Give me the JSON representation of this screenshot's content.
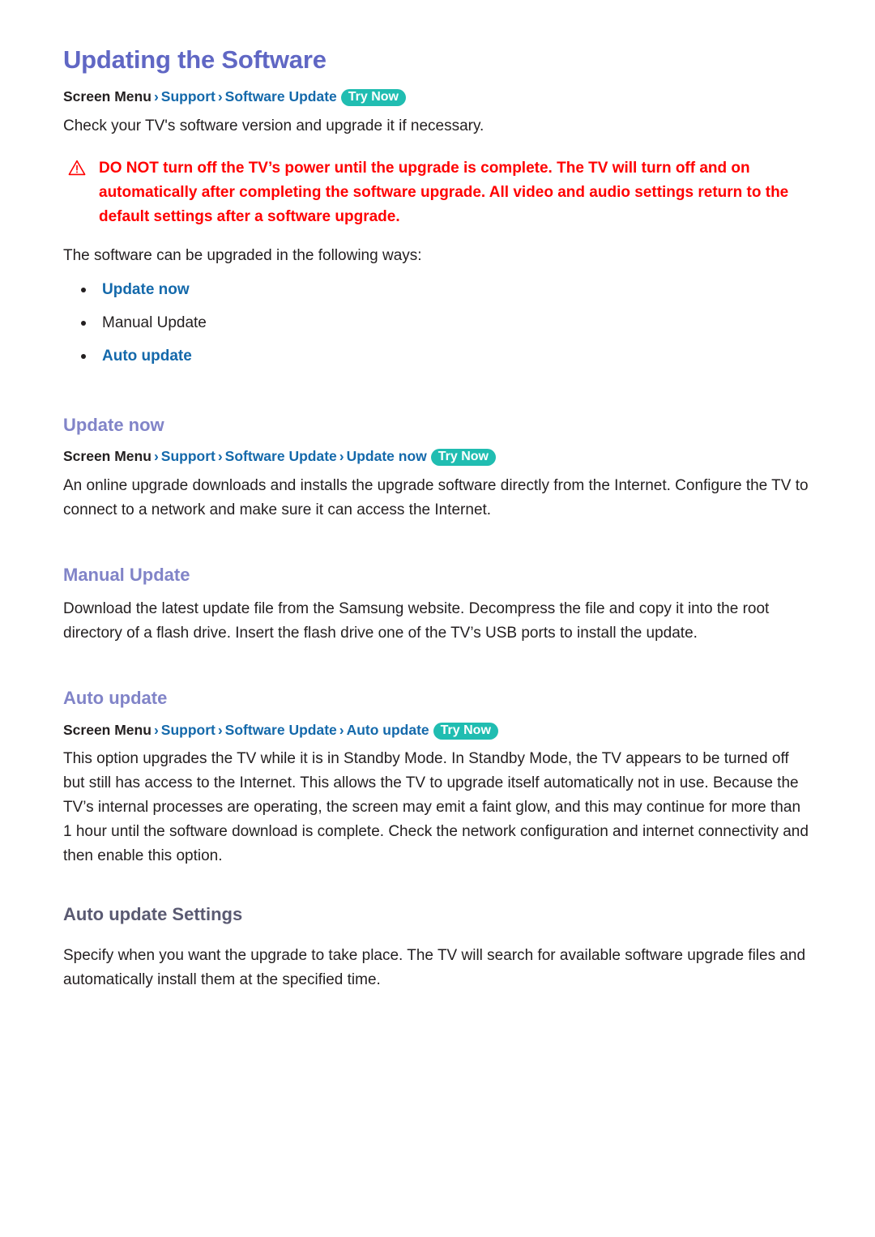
{
  "document": {
    "title": "Updating the Software"
  },
  "intro": {
    "breadcrumb": {
      "root": "Screen Menu",
      "sep": "›",
      "items": [
        "Support",
        "Software Update"
      ],
      "badge": "Try Now"
    },
    "paragraph": "Check your TV's software version and upgrade it if necessary.",
    "warning": {
      "icon": "warning-triangle-icon",
      "text": "DO NOT turn off the TV’s power until the upgrade is complete. The TV will turn off and on automatically after completing the software upgrade. All video and audio settings return to the default settings after a software upgrade."
    },
    "ways_lead": "The software can be upgraded in the following ways:",
    "ways": [
      {
        "label": "Update now",
        "link": true
      },
      {
        "label": "Manual Update",
        "link": false
      },
      {
        "label": "Auto update",
        "link": true
      }
    ]
  },
  "sections": [
    {
      "heading": "Update now",
      "breadcrumb": {
        "root": "Screen Menu",
        "sep": "›",
        "items": [
          "Support",
          "Software Update",
          "Update now"
        ],
        "badge": "Try Now"
      },
      "paragraph": "An online upgrade downloads and installs the upgrade software directly from the Internet. Configure the TV to connect to a network and make sure it can access the Internet."
    },
    {
      "heading": "Manual Update",
      "paragraph": "Download the latest update file from the Samsung website. Decompress the file and copy it into the root directory of a flash drive. Insert the flash drive one of the TV’s USB ports to install the update."
    },
    {
      "heading": "Auto update",
      "breadcrumb": {
        "root": "Screen Menu",
        "sep": "›",
        "items": [
          "Support",
          "Software Update",
          "Auto update"
        ],
        "badge": "Try Now"
      },
      "paragraph": "This option upgrades the TV while it is in Standby Mode. In Standby Mode, the TV appears to be turned off but still has access to the Internet. This allows the TV to upgrade itself automatically not in use. Because the TV’s internal processes are operating, the screen may emit a faint glow, and this may continue for more than 1 hour until the software download is complete. Check the network configuration and internet connectivity and then enable this option."
    }
  ],
  "subsection": {
    "heading": "Auto update Settings",
    "paragraph": "Specify when you want the upgrade to take place. The TV will search for available software upgrade files and automatically install them at the specified time."
  },
  "colors": {
    "title_purple": "#6067c4",
    "heading_purple": "#8184c8",
    "subheading_slate": "#5a5a72",
    "link_blue": "#1469ab",
    "badge_teal": "#20bdb1",
    "warning_red": "#ff0000",
    "body_text": "#231f20"
  }
}
